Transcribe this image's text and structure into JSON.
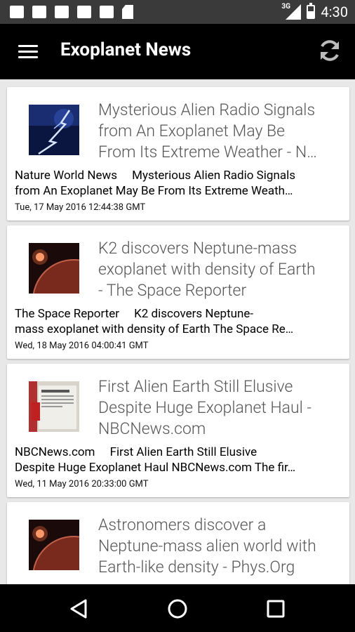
{
  "status_bar": {
    "network": "3G",
    "time": "4:30"
  },
  "app_bar": {
    "title": "Exoplanet News"
  },
  "articles": [
    {
      "title_l1": "Mysterious Alien Radio Signals",
      "title_l2": "from An Exoplanet May Be",
      "title_l3": "From Its Extreme Weather - N…",
      "source": "Nature World News",
      "body_l1_rest": "Mysterious Alien Radio Signals",
      "body_l2": "from An Exoplanet May Be From Its Extreme Weath…",
      "date": "Tue, 17 May 2016 12:44:38 GMT",
      "thumb": "lightning-storm"
    },
    {
      "title_l1": "K2 discovers Neptune-mass",
      "title_l2": "exoplanet with density of Earth",
      "title_l3": "- The Space Reporter",
      "source": "The Space Reporter",
      "body_l1_rest": "K2 discovers Neptune-",
      "body_l2": "mass exoplanet with density of Earth The Space Re…",
      "date": "Wed, 18 May 2016 04:00:41 GMT",
      "thumb": "red-planet"
    },
    {
      "title_l1": "First Alien Earth Still Elusive",
      "title_l2": "Despite Huge Exoplanet Haul -",
      "title_l3": "NBCNews.com",
      "source": "NBCNews.com",
      "body_l1_rest": "First Alien Earth Still Elusive",
      "body_l2": "Despite Huge Exoplanet Haul NBCNews.com The fir…",
      "date": "Wed, 11 May 2016 20:33:00 GMT",
      "thumb": "newspaper"
    },
    {
      "title_l1": "Astronomers discover a",
      "title_l2": "Neptune-mass alien world with",
      "title_l3": "Earth-like density - Phys.Org",
      "thumb": "red-planet"
    }
  ],
  "colors": {
    "app_bar": "#000000",
    "status_bar": "#3a3a3a",
    "background": "#e8e8e8",
    "title_text": "#555555"
  }
}
